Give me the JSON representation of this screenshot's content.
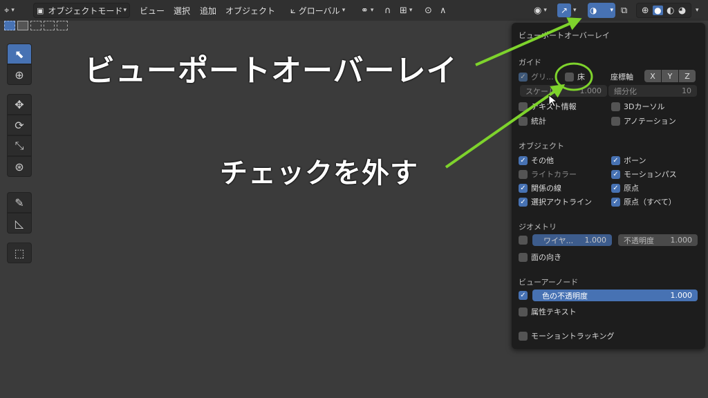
{
  "header": {
    "mode": "オブジェクトモード",
    "menu": [
      "ビュー",
      "選択",
      "追加",
      "オブジェクト"
    ],
    "orientation": "グローバル"
  },
  "annotations": {
    "title": "ビューポートオーバーレイ",
    "instruction": "チェックを外す",
    "highlight_color": "#7ed32c"
  },
  "panel": {
    "title": "ビューポートオーバーレイ",
    "guides": {
      "label": "ガイド",
      "grid": "グリ...",
      "floor": "床",
      "axes_label": "座標軸",
      "axes": [
        "X",
        "Y",
        "Z"
      ],
      "scale_label": "スケール",
      "scale_value": "1.000",
      "subdivisions_label": "細分化",
      "subdivisions_value": "10",
      "text_info": "テキスト情報",
      "cursor3d": "3Dカーソル",
      "stats": "統計",
      "annotations": "アノテーション"
    },
    "objects": {
      "label": "オブジェクト",
      "extras": "その他",
      "bones": "ボーン",
      "light_colors": "ライトカラー",
      "motion_paths": "モーションパス",
      "relationship_lines": "関係の線",
      "origins": "原点",
      "outline_selected": "選択アウトライン",
      "origins_all": "原点（すべて）"
    },
    "geometry": {
      "label": "ジオメトリ",
      "wireframe_label": "ワイヤ...",
      "wireframe_value": "1.000",
      "opacity_label": "不透明度",
      "opacity_value": "1.000",
      "face_orientation": "面の向き"
    },
    "viewer_node": {
      "label": "ビューアーノード",
      "color_opacity_label": "色の不透明度",
      "color_opacity_value": "1.000",
      "attribute_text": "属性テキスト"
    },
    "motion_tracking": "モーショントラッキング"
  }
}
